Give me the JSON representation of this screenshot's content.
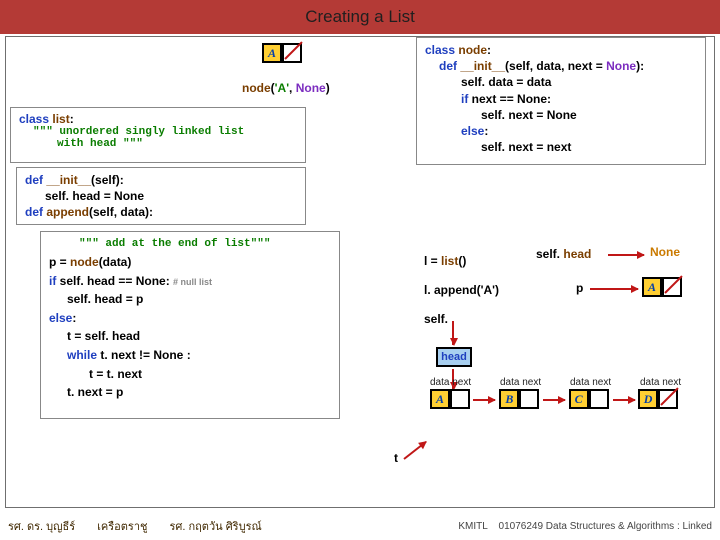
{
  "title": "Creating a List",
  "top_diagram": {
    "cell_letter": "A",
    "call": "node('A', None)",
    "call_parts": {
      "fn": "node",
      "open": "(",
      "arg1": "'A'",
      "comma": ", ",
      "arg2": "None",
      "close": ")"
    }
  },
  "node_class": {
    "line1": {
      "kw": "class ",
      "name": "node",
      "colon": ":"
    },
    "init_sig": {
      "kw": "def ",
      "name": "__init__",
      "args": "(self, data, next = ",
      "none": "None",
      "close": "):"
    },
    "l3": "self. data = data",
    "l4": {
      "kw": "if ",
      "rest": "next == None:"
    },
    "l5": "self. next = None",
    "l6": {
      "kw": "else",
      "colon": ":"
    },
    "l7": "self. next = next"
  },
  "list_class": {
    "line1": {
      "kw": "class ",
      "name": "list",
      "colon": ":"
    },
    "doc1": "\"\"\" unordered singly linked list",
    "doc2": "with head \"\"\"",
    "init": {
      "kw": "def ",
      "name": "__init__",
      "args": "(self):"
    },
    "init_body": "self. head = None",
    "append_sig": {
      "kw": "def ",
      "name": "append",
      "args": "(self, data):"
    },
    "append_doc": "\"\"\" add at the end of list\"\"\"",
    "b1": {
      "pre": "p =  ",
      "fn": "node",
      "post": "(data)"
    },
    "b2": {
      "kw": "if ",
      "rest": "self. head == None: ",
      "comment": "# null list"
    },
    "b3": "self. head = p",
    "b4": {
      "kw": "else",
      "colon": ":"
    },
    "b5": "t = self. head",
    "b6": {
      "kw": "while",
      "cond": "   t. next != None",
      "colon": "    :"
    },
    "b7": "t = t. next",
    "b8": "t. next = p"
  },
  "right_calls": {
    "l_eq": "l = ",
    "list_fn": "list",
    "list_call": "()",
    "append": "l. append('A')",
    "self_label": "self.",
    "selfhead_pre": "self. ",
    "selfhead_head": "head",
    "none": "None",
    "p": "p",
    "head": "head",
    "datanext": "data next",
    "A": "A",
    "B": "B",
    "C": "C",
    "D": "D",
    "t": "t"
  },
  "footer": {
    "name1": "รศ. ดร. บุญธีร์",
    "name2": "เครือตราชู",
    "name3": "รศ. กฤตวัน   ศิริบูรณ์",
    "inst": "KMITL",
    "course": "01076249 Data Structures & Algorithms : Linked"
  }
}
